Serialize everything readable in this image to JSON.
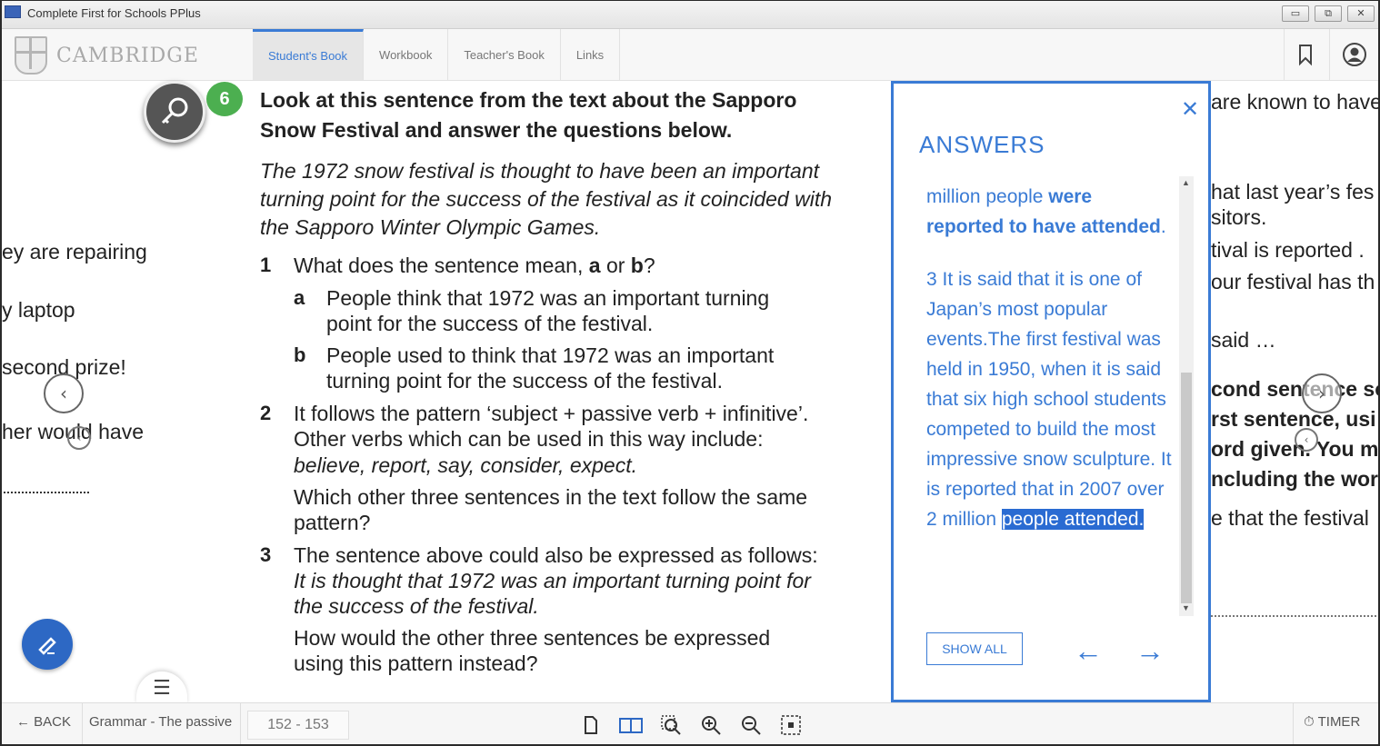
{
  "window": {
    "title": "Complete First for Schools PPlus",
    "buttons": [
      "▭",
      "⧉",
      "✕"
    ]
  },
  "header": {
    "logo": "CAMBRIDGE",
    "tabs": [
      {
        "label": "Student's Book"
      },
      {
        "label": "Workbook"
      },
      {
        "label": "Teacher's Book"
      },
      {
        "label": "Links"
      }
    ]
  },
  "left_page": {
    "fragments": [
      "ey are repairing",
      "y laptop",
      "second prize!",
      "her would have"
    ]
  },
  "exercise": {
    "number": "6",
    "heading": "Look at this sentence from the text about the Sapporo Snow Festival and answer the questions below.",
    "quote": "The 1972 snow festival is thought to have been an important turning point for the success of the festival as it coincided with the Sapporo Winter Olympic Games.",
    "q1": {
      "num": "1",
      "pre": "What does the sentence mean, ",
      "a": "a",
      "or": " or ",
      "b": "b",
      "post": "?",
      "options": [
        {
          "letter": "a",
          "line1": "People think that 1972 was an important turning",
          "line2": "point for the success of the festival."
        },
        {
          "letter": "b",
          "line1": "People used to think that 1972 was an important",
          "line2": "turning point for the success of the festival."
        }
      ]
    },
    "q2": {
      "num": "2",
      "line1": "It follows the pattern ‘subject + passive verb + infinitive’.",
      "line2": "Other verbs which can be used in this way include:",
      "verbs": "believe, report, say, consider, expect.",
      "line4": "Which other three sentences in the text follow the same",
      "line5": "pattern?"
    },
    "q3": {
      "num": "3",
      "line1": "The sentence above could also be expressed as follows:",
      "italic1": "It is thought that 1972 was an important turning point for",
      "italic2": "the success of the festival.",
      "line4": "How would the other three sentences be expressed",
      "line5": "using this pattern instead?"
    }
  },
  "right_page": {
    "fragments": [
      "are known to have",
      "hat last year’s fes",
      "sitors.",
      "tival is reported .",
      "our festival has th",
      "said …",
      "cond sentence so",
      "rst sentence, usi",
      "ord given. You m",
      "ncluding the wor",
      "e that the festival"
    ]
  },
  "answers": {
    "title": "ANSWERS",
    "close": "✕",
    "part1_pre": "million people ",
    "part1_bold": "were reported to have attended",
    "part1_post": ".",
    "part2": "3 It is said that it is one of Japan’s most popular events.The first festival was held in 1950, when it is said that six high school students competed to build the most impressive snow sculpture. It is reported that in 2007 over 2 million ",
    "part2_highlight": "people attended.",
    "show_all": "SHOW ALL",
    "prev": "←",
    "next": "→"
  },
  "footer": {
    "back": "BACK",
    "breadcrumb": "Grammar - The passive",
    "pages": "152 - 153",
    "timer": "TIMER"
  },
  "colors": {
    "accent": "#3a7bd5",
    "badge": "#4caf50",
    "edit": "#2d68c4"
  }
}
